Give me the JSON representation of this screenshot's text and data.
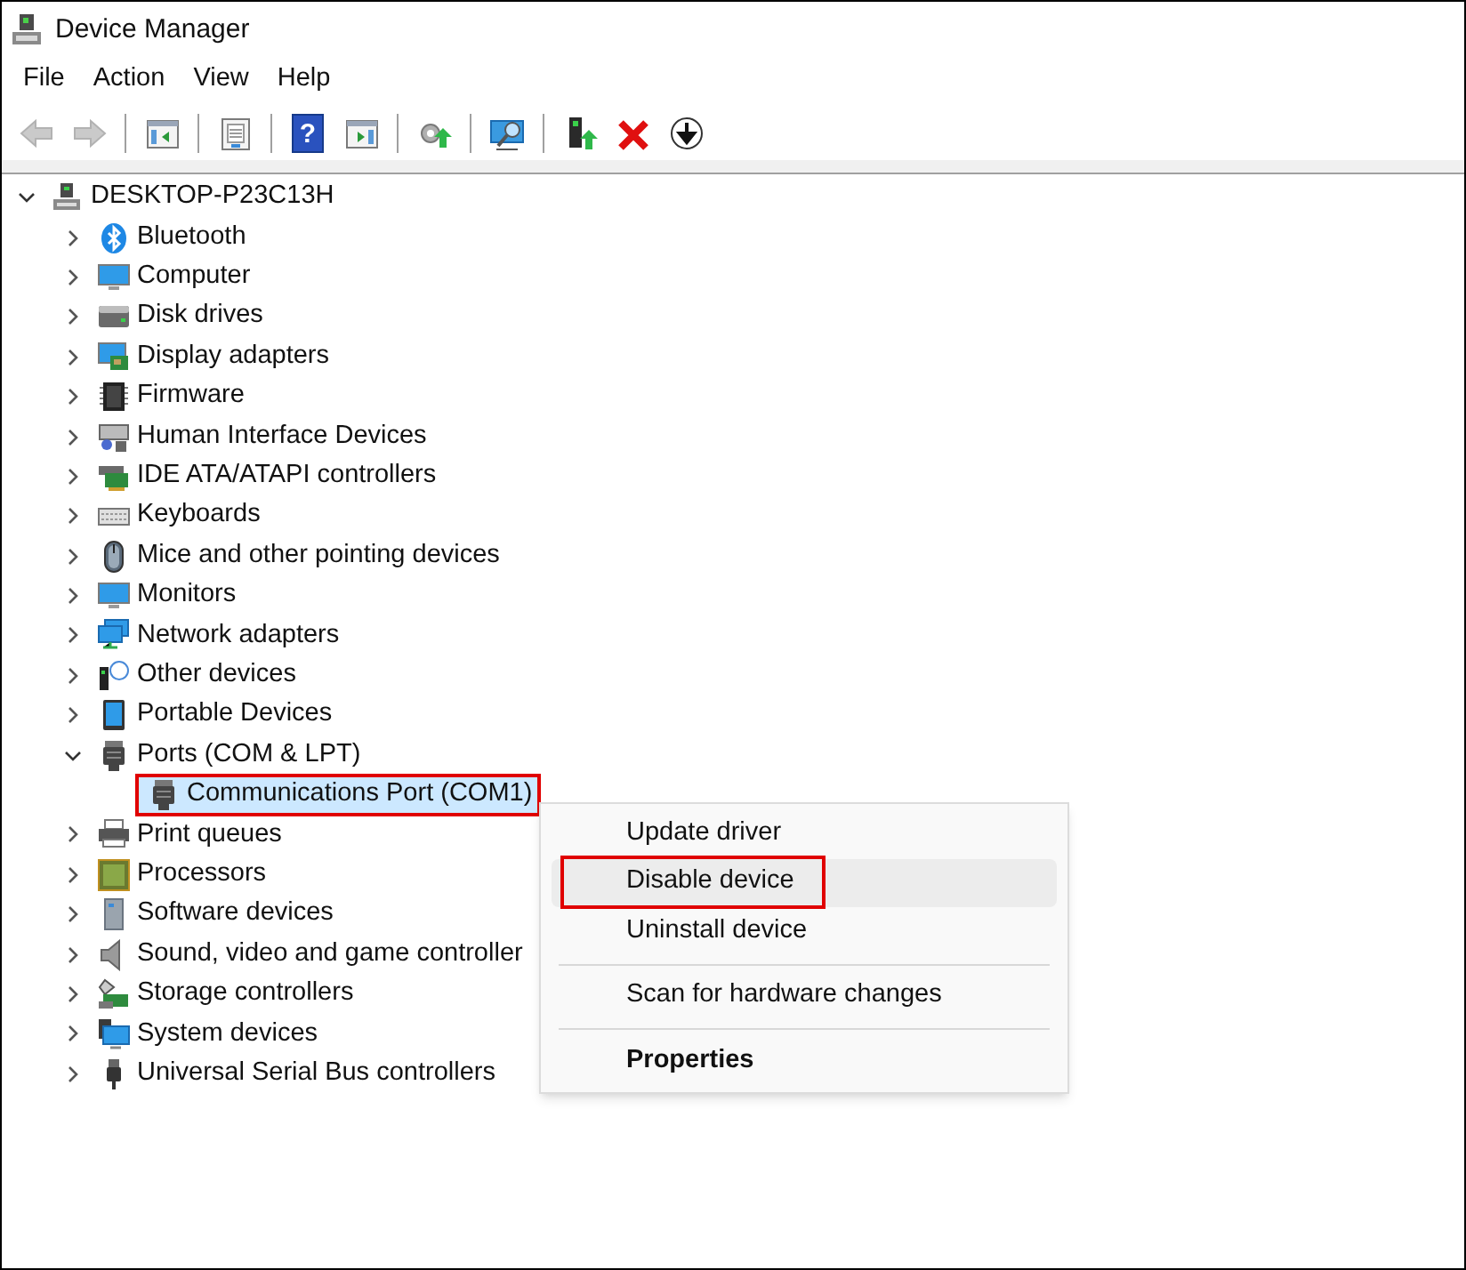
{
  "window": {
    "title": "Device Manager"
  },
  "menu_bar": [
    "File",
    "Action",
    "View",
    "Help"
  ],
  "toolbar": [
    {
      "kind": "back",
      "disabled": true
    },
    {
      "kind": "forward",
      "disabled": true
    },
    {
      "kind": "separator"
    },
    {
      "kind": "console-tree"
    },
    {
      "kind": "separator"
    },
    {
      "kind": "properties"
    },
    {
      "kind": "separator"
    },
    {
      "kind": "help",
      "glyph": "?"
    },
    {
      "kind": "action-pane"
    },
    {
      "kind": "separator"
    },
    {
      "kind": "update-driver"
    },
    {
      "kind": "separator"
    },
    {
      "kind": "scan"
    },
    {
      "kind": "separator"
    },
    {
      "kind": "enable"
    },
    {
      "kind": "uninstall"
    },
    {
      "kind": "disable"
    }
  ],
  "tree": {
    "label": "DESKTOP-P23C13H",
    "kind": "computer-root",
    "expanded": true,
    "children": [
      {
        "label": "Bluetooth",
        "kind": "bluetooth",
        "expanded": false
      },
      {
        "label": "Computer",
        "kind": "monitor",
        "expanded": false
      },
      {
        "label": "Disk drives",
        "kind": "disk",
        "expanded": false
      },
      {
        "label": "Display adapters",
        "kind": "display",
        "expanded": false
      },
      {
        "label": "Firmware",
        "kind": "chip",
        "expanded": false
      },
      {
        "label": "Human Interface Devices",
        "kind": "hid",
        "expanded": false
      },
      {
        "label": "IDE ATA/ATAPI controllers",
        "kind": "card",
        "expanded": false
      },
      {
        "label": "Keyboards",
        "kind": "keyboard",
        "expanded": false
      },
      {
        "label": "Mice and other pointing devices",
        "kind": "mouse",
        "expanded": false
      },
      {
        "label": "Monitors",
        "kind": "monitor",
        "expanded": false
      },
      {
        "label": "Network adapters",
        "kind": "network",
        "expanded": false
      },
      {
        "label": "Other devices",
        "kind": "unknown",
        "expanded": false
      },
      {
        "label": "Portable Devices",
        "kind": "portable",
        "expanded": false
      },
      {
        "label": "Ports (COM & LPT)",
        "kind": "port",
        "expanded": true,
        "children": [
          {
            "label": "Communications Port (COM1)",
            "kind": "port",
            "selected": true,
            "annotated": true
          }
        ]
      },
      {
        "label": "Print queues",
        "kind": "printer",
        "expanded": false
      },
      {
        "label": "Processors",
        "kind": "processor",
        "expanded": false
      },
      {
        "label": "Software devices",
        "kind": "tower",
        "expanded": false
      },
      {
        "label": "Sound, video and game controller",
        "kind": "speaker",
        "expanded": false
      },
      {
        "label": "Storage controllers",
        "kind": "storage",
        "expanded": false
      },
      {
        "label": "System devices",
        "kind": "system",
        "expanded": false
      },
      {
        "label": "Universal Serial Bus controllers",
        "kind": "usb",
        "expanded": false
      }
    ]
  },
  "context_menu": [
    {
      "label": "Update driver",
      "kind": "item",
      "selected": false,
      "annotated": false,
      "bold": false
    },
    {
      "label": "Disable device",
      "kind": "item",
      "selected": true,
      "annotated": true,
      "bold": false
    },
    {
      "label": "Uninstall device",
      "kind": "item",
      "selected": false,
      "annotated": false,
      "bold": false
    },
    {
      "kind": "separator"
    },
    {
      "label": "Scan for hardware changes",
      "kind": "item",
      "selected": false,
      "annotated": false,
      "bold": false
    },
    {
      "kind": "separator"
    },
    {
      "label": "Properties",
      "kind": "item",
      "selected": false,
      "annotated": false,
      "bold": true
    }
  ]
}
